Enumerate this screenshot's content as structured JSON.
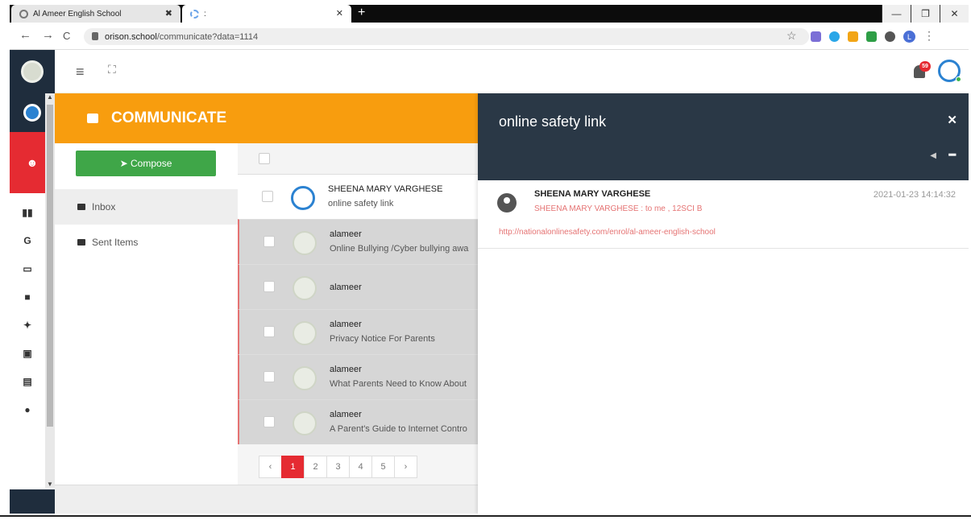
{
  "browser": {
    "tabs": [
      {
        "title": "Al Ameer English School",
        "close": "✖"
      },
      {
        "title": ":",
        "close": "✕"
      }
    ],
    "new_tab": "+",
    "window_controls": {
      "minimize": "—",
      "restore": "❐",
      "close": "✕"
    },
    "nav": {
      "back": "←",
      "forward": "→",
      "reload": "C"
    },
    "url_host": "orison.school",
    "url_path": "/communicate?data=1114",
    "bookmark_star": "☆",
    "profile_initial": "L",
    "menu": "⋮"
  },
  "sidebar": {
    "icons": [
      "settings-icon",
      "google-icon",
      "monitor-icon",
      "chat-icon",
      "group-icon",
      "calendar-icon",
      "copy-icon",
      "location-icon"
    ],
    "glyphs": [
      "▮▮",
      "G",
      "▭",
      "■",
      "✦",
      "▣",
      "▤",
      "●"
    ]
  },
  "topbar": {
    "menu_glyph": "≡",
    "fullscreen_glyph": "⛶",
    "notification_count": "59"
  },
  "communicate": {
    "title": "COMMUNICATE",
    "compose_label": "➤ Compose",
    "folders": [
      {
        "label": "Inbox",
        "active": true
      },
      {
        "label": "Sent Items",
        "active": false
      }
    ]
  },
  "messages": [
    {
      "sender": "SHEENA MARY VARGHESE",
      "subject": "online safety link",
      "read": true
    },
    {
      "sender": "alameer",
      "subject": "Online Bullying /Cyber bullying awa",
      "read": false
    },
    {
      "sender": "alameer",
      "subject": "",
      "read": false
    },
    {
      "sender": "alameer",
      "subject": "Privacy Notice For Parents",
      "read": false
    },
    {
      "sender": "alameer",
      "subject": "What Parents Need to Know About",
      "read": false
    },
    {
      "sender": "alameer",
      "subject": "A Parent's Guide to Internet Contro",
      "read": false
    }
  ],
  "pagination": [
    "‹",
    "1",
    "2",
    "3",
    "4",
    "5",
    "›"
  ],
  "pagination_active": "1",
  "panel": {
    "title": "online safety link",
    "close": "✕",
    "reply_glyph": "◀",
    "minimize_glyph": "━",
    "from": "SHEENA MARY VARGHESE",
    "to_line": "SHEENA MARY VARGHESE : to me , 12SCI B",
    "date": "2021-01-23 14:14:32",
    "link": "http://nationalonlinesafety.com/enrol/al-ameer-english-school"
  },
  "colors": {
    "accent_orange": "#f89d0e",
    "compose_green": "#3fa648",
    "panel_header": "#2a3846",
    "alert_red": "#e52b32"
  }
}
